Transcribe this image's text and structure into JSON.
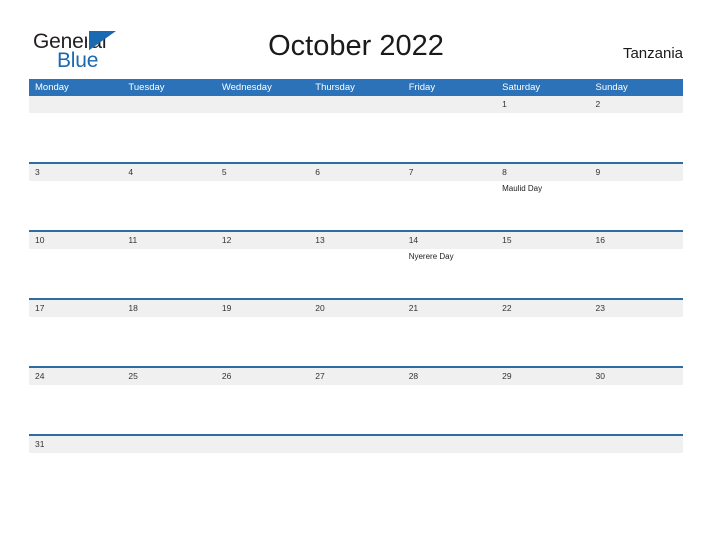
{
  "brand": {
    "name_part1": "General",
    "name_part2": "Blue",
    "color_dark": "#231f20",
    "color_blue": "#1b69b0"
  },
  "header": {
    "title": "October 2022",
    "country": "Tanzania"
  },
  "theme": {
    "header_blue": "#2c72b8",
    "divider_blue": "#2e6da4",
    "date_band_gray": "#f0f0f0"
  },
  "calendar": {
    "weekdays": [
      "Monday",
      "Tuesday",
      "Wednesday",
      "Thursday",
      "Friday",
      "Saturday",
      "Sunday"
    ],
    "weeks": [
      {
        "days": [
          {
            "date": "",
            "event": ""
          },
          {
            "date": "",
            "event": ""
          },
          {
            "date": "",
            "event": ""
          },
          {
            "date": "",
            "event": ""
          },
          {
            "date": "",
            "event": ""
          },
          {
            "date": "1",
            "event": ""
          },
          {
            "date": "2",
            "event": ""
          }
        ]
      },
      {
        "days": [
          {
            "date": "3",
            "event": ""
          },
          {
            "date": "4",
            "event": ""
          },
          {
            "date": "5",
            "event": ""
          },
          {
            "date": "6",
            "event": ""
          },
          {
            "date": "7",
            "event": ""
          },
          {
            "date": "8",
            "event": "Maulid Day"
          },
          {
            "date": "9",
            "event": ""
          }
        ]
      },
      {
        "days": [
          {
            "date": "10",
            "event": ""
          },
          {
            "date": "11",
            "event": ""
          },
          {
            "date": "12",
            "event": ""
          },
          {
            "date": "13",
            "event": ""
          },
          {
            "date": "14",
            "event": "Nyerere Day"
          },
          {
            "date": "15",
            "event": ""
          },
          {
            "date": "16",
            "event": ""
          }
        ]
      },
      {
        "days": [
          {
            "date": "17",
            "event": ""
          },
          {
            "date": "18",
            "event": ""
          },
          {
            "date": "19",
            "event": ""
          },
          {
            "date": "20",
            "event": ""
          },
          {
            "date": "21",
            "event": ""
          },
          {
            "date": "22",
            "event": ""
          },
          {
            "date": "23",
            "event": ""
          }
        ]
      },
      {
        "days": [
          {
            "date": "24",
            "event": ""
          },
          {
            "date": "25",
            "event": ""
          },
          {
            "date": "26",
            "event": ""
          },
          {
            "date": "27",
            "event": ""
          },
          {
            "date": "28",
            "event": ""
          },
          {
            "date": "29",
            "event": ""
          },
          {
            "date": "30",
            "event": ""
          }
        ]
      },
      {
        "last": true,
        "days": [
          {
            "date": "31",
            "event": ""
          },
          {
            "date": "",
            "event": ""
          },
          {
            "date": "",
            "event": ""
          },
          {
            "date": "",
            "event": ""
          },
          {
            "date": "",
            "event": ""
          },
          {
            "date": "",
            "event": ""
          },
          {
            "date": "",
            "event": ""
          }
        ]
      }
    ]
  }
}
